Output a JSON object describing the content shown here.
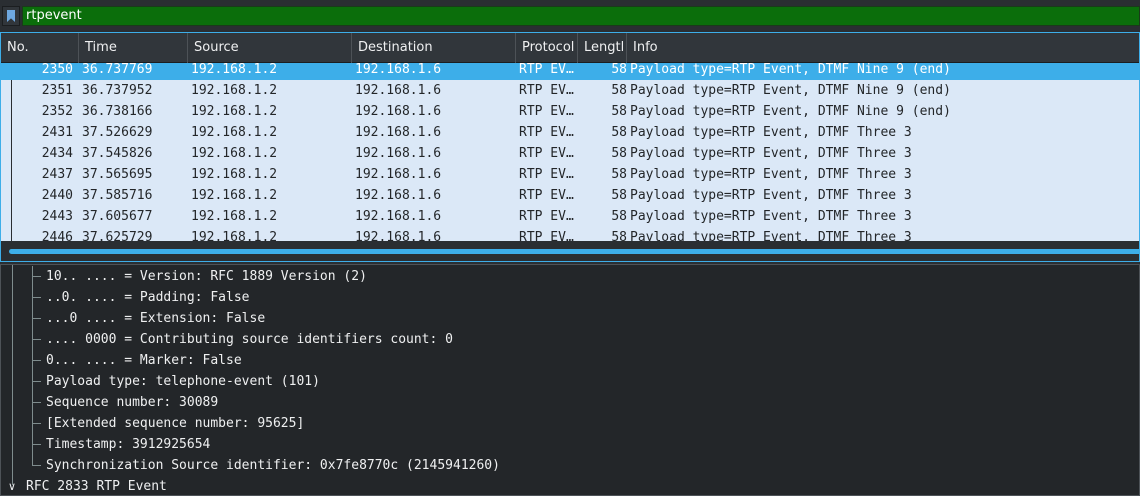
{
  "filter": {
    "value": "rtpevent"
  },
  "columns": {
    "no": "No.",
    "time": "Time",
    "source": "Source",
    "destination": "Destination",
    "protocol": "Protocol",
    "length": "Lengtl",
    "info": "Info"
  },
  "packets": [
    {
      "no": "2350",
      "time": "36.737769",
      "source": "192.168.1.2",
      "destination": "192.168.1.6",
      "protocol": "RTP EV…",
      "length": "58",
      "info": "Payload type=RTP Event, DTMF Nine 9 (end)"
    },
    {
      "no": "2351",
      "time": "36.737952",
      "source": "192.168.1.2",
      "destination": "192.168.1.6",
      "protocol": "RTP EV…",
      "length": "58",
      "info": "Payload type=RTP Event, DTMF Nine 9 (end)"
    },
    {
      "no": "2352",
      "time": "36.738166",
      "source": "192.168.1.2",
      "destination": "192.168.1.6",
      "protocol": "RTP EV…",
      "length": "58",
      "info": "Payload type=RTP Event, DTMF Nine 9 (end)"
    },
    {
      "no": "2431",
      "time": "37.526629",
      "source": "192.168.1.2",
      "destination": "192.168.1.6",
      "protocol": "RTP EV…",
      "length": "58",
      "info": "Payload type=RTP Event, DTMF Three 3"
    },
    {
      "no": "2434",
      "time": "37.545826",
      "source": "192.168.1.2",
      "destination": "192.168.1.6",
      "protocol": "RTP EV…",
      "length": "58",
      "info": "Payload type=RTP Event, DTMF Three 3"
    },
    {
      "no": "2437",
      "time": "37.565695",
      "source": "192.168.1.2",
      "destination": "192.168.1.6",
      "protocol": "RTP EV…",
      "length": "58",
      "info": "Payload type=RTP Event, DTMF Three 3"
    },
    {
      "no": "2440",
      "time": "37.585716",
      "source": "192.168.1.2",
      "destination": "192.168.1.6",
      "protocol": "RTP EV…",
      "length": "58",
      "info": "Payload type=RTP Event, DTMF Three 3"
    },
    {
      "no": "2443",
      "time": "37.605677",
      "source": "192.168.1.2",
      "destination": "192.168.1.6",
      "protocol": "RTP EV…",
      "length": "58",
      "info": "Payload type=RTP Event, DTMF Three 3"
    },
    {
      "no": "2446",
      "time": "37.625729",
      "source": "192.168.1.2",
      "destination": "192.168.1.6",
      "protocol": "RTP EV…",
      "length": "58",
      "info": "Payload type=RTP Event, DTMF Three 3"
    }
  ],
  "details": [
    "10.. .... = Version: RFC 1889 Version (2)",
    "..0. .... = Padding: False",
    "...0 .... = Extension: False",
    ".... 0000 = Contributing source identifiers count: 0",
    "0... .... = Marker: False",
    "Payload type: telephone-event (101)",
    "Sequence number: 30089",
    "[Extended sequence number: 95625]",
    "Timestamp: 3912925654",
    "Synchronization Source identifier: 0x7fe8770c (2145941260)"
  ],
  "section": {
    "label": "RFC 2833 RTP Event",
    "icon": "chevron-down-icon"
  },
  "colors": {
    "selected": "#3daee9",
    "row_bg": "#dbe8f7",
    "filter_valid": "#0b6e0b",
    "detail_bg": "#232629"
  }
}
